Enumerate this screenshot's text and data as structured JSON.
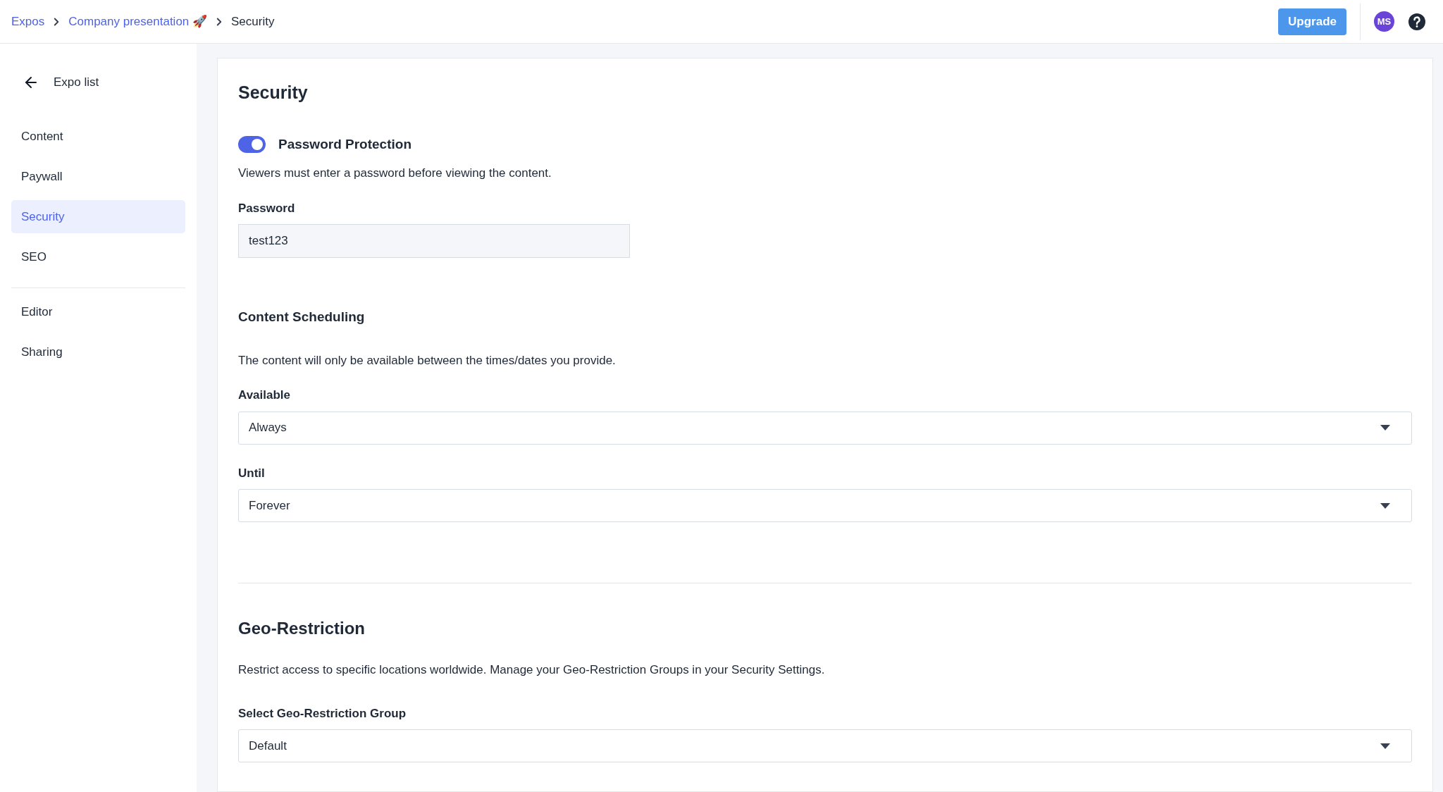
{
  "breadcrumbs": [
    {
      "label": "Expos",
      "kind": "link"
    },
    {
      "label": "Company presentation 🚀",
      "kind": "link"
    },
    {
      "label": "Security",
      "kind": "current"
    }
  ],
  "header": {
    "upgrade": "Upgrade",
    "avatar": "MS"
  },
  "sidebar": {
    "back": "Expo list",
    "groups": [
      [
        {
          "label": "Content",
          "selected": false
        },
        {
          "label": "Paywall",
          "selected": false
        },
        {
          "label": "Security",
          "selected": true
        },
        {
          "label": "SEO",
          "selected": false
        }
      ],
      [
        {
          "label": "Editor",
          "selected": false
        },
        {
          "label": "Sharing",
          "selected": false
        }
      ]
    ]
  },
  "page": {
    "title": "Security",
    "password_protection": {
      "label": "Password Protection",
      "on": true,
      "description": "Viewers must enter a password before viewing the content.",
      "field_label": "Password",
      "value": "test123"
    },
    "scheduling": {
      "title": "Content Scheduling",
      "description": "The content will only be available between the times/dates you provide.",
      "selects": [
        {
          "label": "Available",
          "value": "Always"
        },
        {
          "label": "Until",
          "value": "Forever"
        }
      ]
    },
    "geo": {
      "title": "Geo-Restriction",
      "description": "Restrict access to specific locations worldwide. Manage your Geo-Restriction Groups in your Security Settings.",
      "select": {
        "label": "Select Geo-Restriction Group",
        "value": "Default"
      }
    }
  }
}
